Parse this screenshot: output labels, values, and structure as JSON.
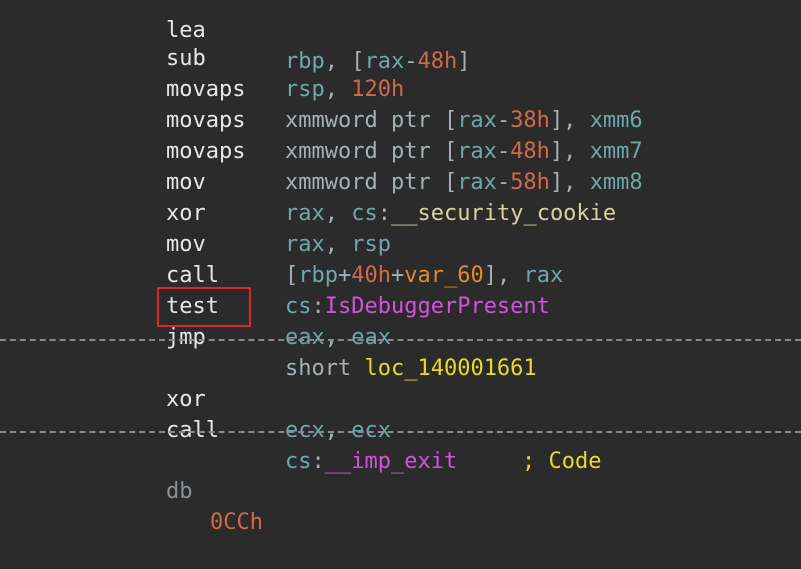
{
  "colors": {
    "background": "#2b2b2b",
    "mnemonic": "#e6e6e6",
    "register": "#6ea6ac",
    "number": "#d0694b",
    "local_var": "#e08b2b",
    "symbol": "#d8d39a",
    "import": "#d451df",
    "label": "#e9d82a",
    "highlight_box": "#d8262c"
  },
  "lines": [
    {
      "mn": "lea",
      "ops": [
        [
          "reg",
          "rbp"
        ],
        [
          "txt",
          ", ["
        ],
        [
          "reg",
          "rax"
        ],
        [
          "txt",
          "-"
        ],
        [
          "num",
          "48h"
        ],
        [
          "txt",
          "]"
        ]
      ]
    },
    {
      "mn": "sub",
      "ops": [
        [
          "reg",
          "rsp"
        ],
        [
          "txt",
          ", "
        ],
        [
          "num",
          "120h"
        ]
      ]
    },
    {
      "mn": "movaps",
      "ops": [
        [
          "txt",
          "xmmword ptr ["
        ],
        [
          "reg",
          "rax"
        ],
        [
          "txt",
          "-"
        ],
        [
          "num",
          "38h"
        ],
        [
          "txt",
          "], "
        ],
        [
          "reg",
          "xmm6"
        ]
      ]
    },
    {
      "mn": "movaps",
      "ops": [
        [
          "txt",
          "xmmword ptr ["
        ],
        [
          "reg",
          "rax"
        ],
        [
          "txt",
          "-"
        ],
        [
          "num",
          "48h"
        ],
        [
          "txt",
          "], "
        ],
        [
          "reg",
          "xmm7"
        ]
      ]
    },
    {
      "mn": "movaps",
      "ops": [
        [
          "txt",
          "xmmword ptr ["
        ],
        [
          "reg",
          "rax"
        ],
        [
          "txt",
          "-"
        ],
        [
          "num",
          "58h"
        ],
        [
          "txt",
          "], "
        ],
        [
          "reg",
          "xmm8"
        ]
      ]
    },
    {
      "mn": "mov",
      "ops": [
        [
          "reg",
          "rax"
        ],
        [
          "txt",
          ", "
        ],
        [
          "reg",
          "cs"
        ],
        [
          "txt",
          ":"
        ],
        [
          "sym",
          "__security_cookie"
        ]
      ]
    },
    {
      "mn": "xor",
      "ops": [
        [
          "reg",
          "rax"
        ],
        [
          "txt",
          ", "
        ],
        [
          "reg",
          "rsp"
        ]
      ]
    },
    {
      "mn": "mov",
      "ops": [
        [
          "txt",
          "["
        ],
        [
          "reg",
          "rbp"
        ],
        [
          "txt",
          "+"
        ],
        [
          "num",
          "40h"
        ],
        [
          "txt",
          "+"
        ],
        [
          "var",
          "var_60"
        ],
        [
          "txt",
          "], "
        ],
        [
          "reg",
          "rax"
        ]
      ]
    },
    {
      "mn": "call",
      "ops": [
        [
          "reg",
          "cs"
        ],
        [
          "txt",
          ":"
        ],
        [
          "fn",
          "IsDebuggerPresent"
        ]
      ]
    },
    {
      "mn": "test",
      "ops": [
        [
          "reg",
          "eax"
        ],
        [
          "txt",
          ", "
        ],
        [
          "reg",
          "eax"
        ]
      ]
    },
    {
      "mn": "jmp",
      "ops": [
        [
          "txt",
          "short "
        ],
        [
          "loc",
          "loc_140001661"
        ]
      ]
    },
    {
      "mn": "xor",
      "ops": [
        [
          "reg",
          "ecx"
        ],
        [
          "txt",
          ", "
        ],
        [
          "reg",
          "ecx"
        ]
      ],
      "comment": "; Code"
    },
    {
      "mn": "call",
      "ops": [
        [
          "reg",
          "cs"
        ],
        [
          "txt",
          ":"
        ],
        [
          "fn",
          "__imp_exit"
        ]
      ]
    },
    {
      "mn": "db",
      "ops": [
        [
          "num",
          "0CCh"
        ]
      ]
    }
  ]
}
